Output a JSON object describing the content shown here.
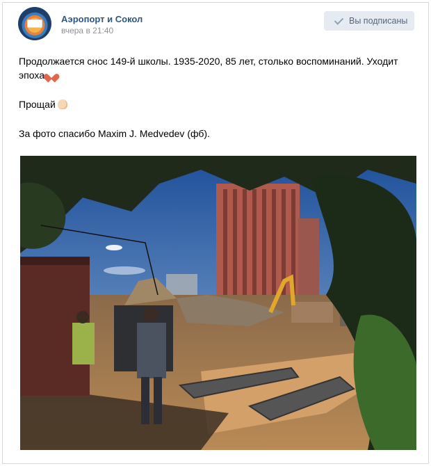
{
  "post": {
    "author": "Аэропорт и Сокол",
    "time": "вчера в 21:40",
    "subscribe_label": "Вы подписаны",
    "text_line1": "Продолжается снос 149-й школы. 1935-2020, 85 лет, столько воспоминаний. Уходит эпоха",
    "text_line2": "Прощай",
    "text_line3": "За фото спасибо Maxim J. Medvedev (фб).",
    "icons": [
      "broken-heart-icon",
      "waving-hand-icon",
      "check-icon"
    ],
    "colors": {
      "author": "#2a5885",
      "button_bg": "#e5ebf1",
      "time": "#939393"
    }
  }
}
